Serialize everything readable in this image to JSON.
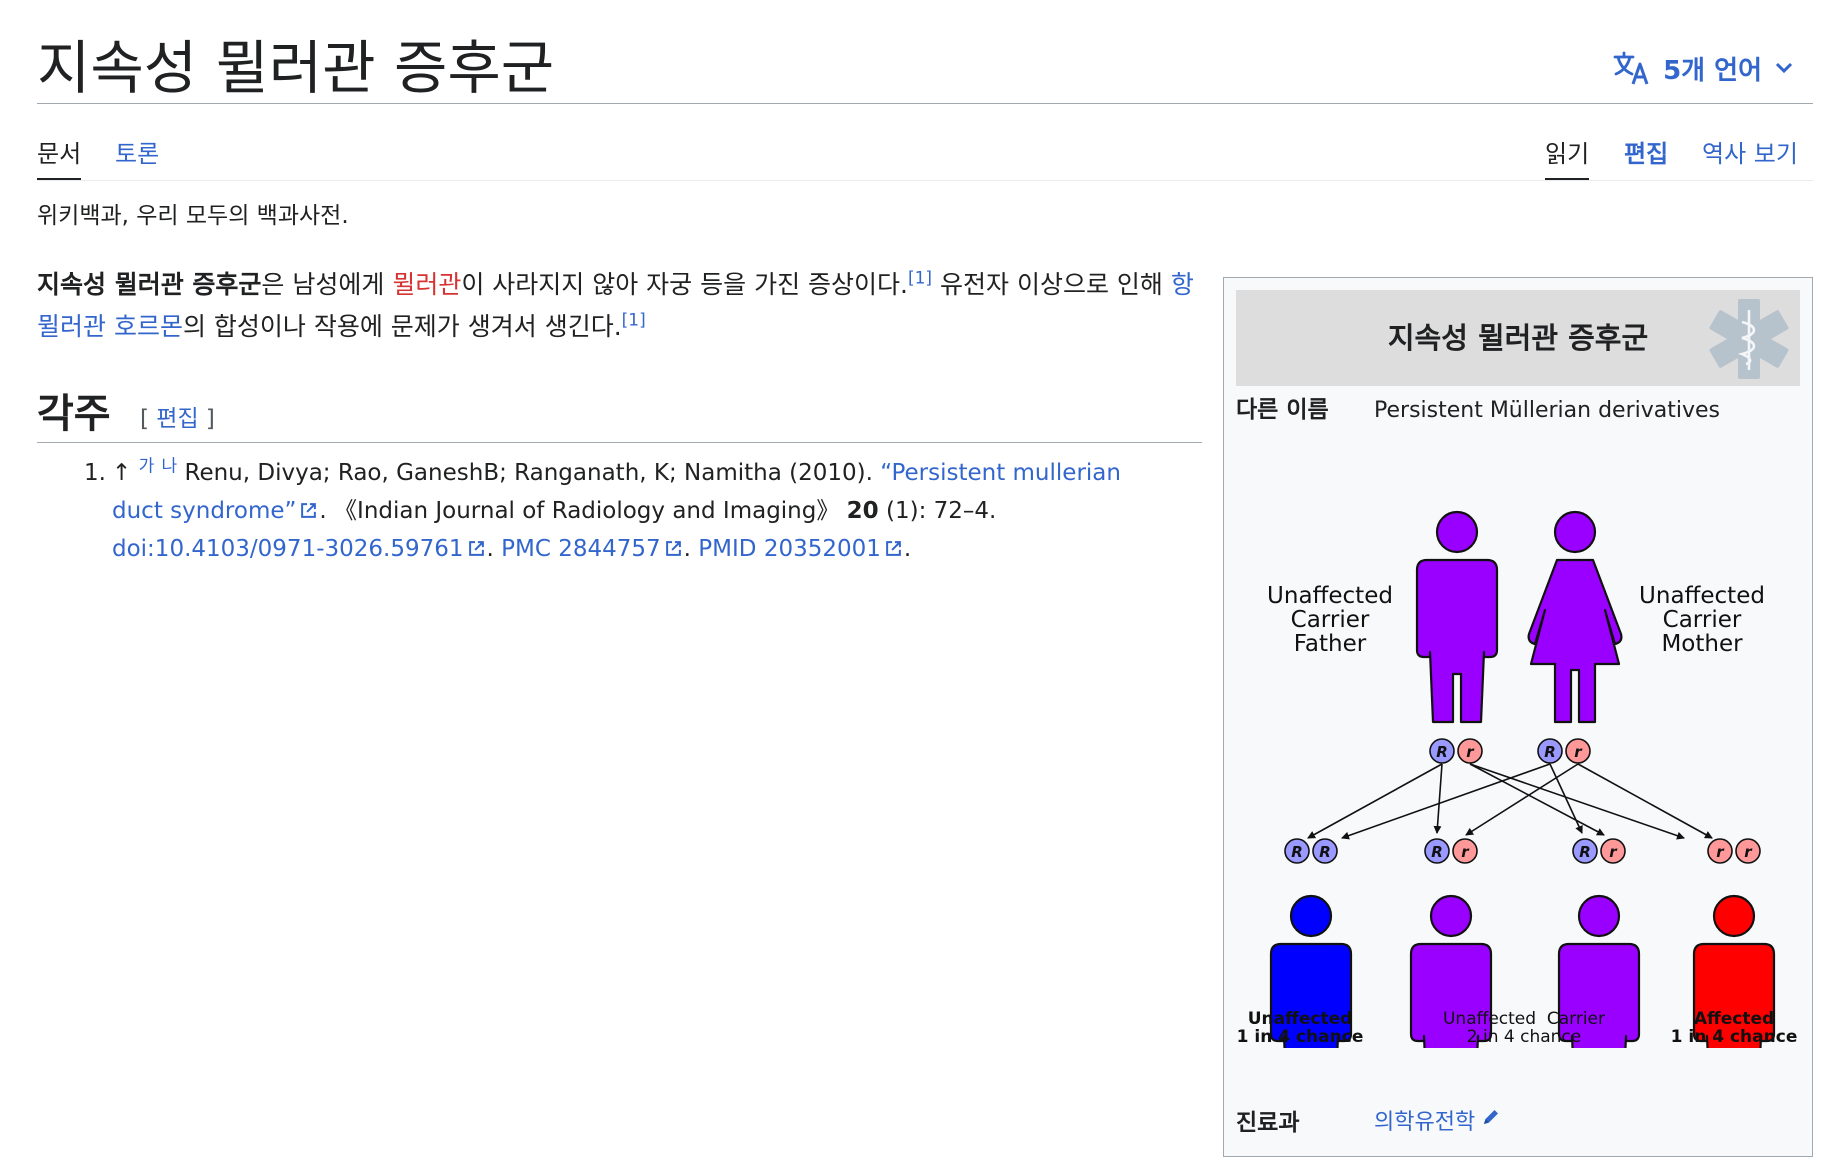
{
  "header": {
    "title": "지속성 뮐러관 증후군",
    "languages_label": "5개 언어"
  },
  "tabs": {
    "article": "문서",
    "talk": "토론",
    "read": "읽기",
    "edit": "편집",
    "history": "역사 보기"
  },
  "tagline": "위키백과, 우리 모두의 백과사전.",
  "lead": {
    "term": "지속성 뮐러관 증후군",
    "t1": "은 남성에게 ",
    "link_mullerian": "뮐러관",
    "t2": "이 사라지지 않아 자궁 등을 가진 증상이다.",
    "ref1": "[1]",
    "t3": " 유전자 이상으로 인해 ",
    "link_amh": "항뮐러관 호르몬",
    "t4": "의 합성이나 작용에 문제가 생겨서 생긴다.",
    "ref2": "[1]"
  },
  "references_section": {
    "heading": "각주",
    "edit_open": "[ ",
    "edit_label": "편집",
    "edit_close": " ]",
    "items": [
      {
        "number": "1.",
        "arrow": "↑",
        "backlink_a": "가",
        "backlink_b": "나",
        "authors": " Renu, Divya; Rao, GaneshB; Ranganath, K; Namitha (2010). ",
        "title_link": "“Persistent mullerian duct syndrome”",
        "journal": ". 《Indian Journal of Radiology and Imaging》 ",
        "volume": "20",
        "pages": " (1): 72–4. ",
        "doi": "doi:10.4103/0971-3026.59761",
        "sep1": ". ",
        "pmc": "PMC 2844757",
        "sep2": ". ",
        "pmid": "PMID 20352001",
        "end": "."
      }
    ]
  },
  "infobox": {
    "title": "지속성 뮐러관 증후군",
    "other_names_label": "다른 이름",
    "other_names_value": "Persistent Müllerian derivatives",
    "specialty_label": "진료과",
    "specialty_value": "의학유전학",
    "diagram": {
      "father_label": [
        "Unaffected",
        "Carrier",
        "Father"
      ],
      "mother_label": [
        "Unaffected",
        "Carrier",
        "Mother"
      ],
      "allele_dominant": "R",
      "allele_recessive": "r",
      "child1": [
        "Unaffected",
        "1 in 4 chance"
      ],
      "child_mid": [
        "Unaffected  Carrier",
        "2 in 4 chance"
      ],
      "child4": [
        "Affected",
        "1 in 4 chance"
      ]
    }
  },
  "colors": {
    "link": "#3366cc",
    "redlink": "#d73333",
    "carrier": "#9900ff",
    "unaffected": "#0000ff",
    "affected": "#ff0000",
    "allele_dominant": "#9999ff",
    "allele_recessive": "#ff9999"
  },
  "icons": [
    "translate-icon",
    "chevron-down-icon",
    "external-link-icon",
    "star-of-life-icon",
    "pencil-icon"
  ]
}
